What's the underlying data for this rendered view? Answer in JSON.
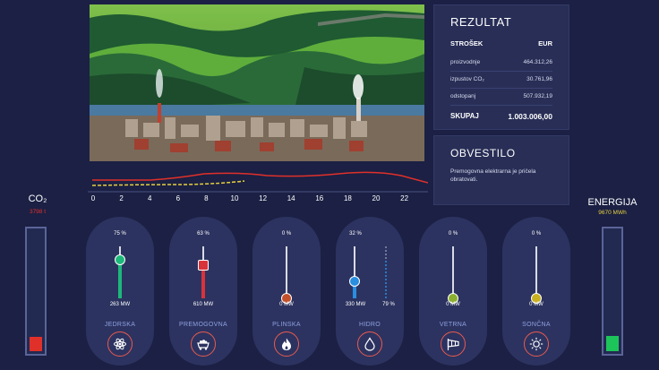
{
  "result": {
    "title": "REZULTAT",
    "col_label": "STROŠEK",
    "col_unit": "EUR",
    "rows": [
      {
        "label": "proizvodnje",
        "value": "464.312,26"
      },
      {
        "label": "izpustov CO₂",
        "value": "30.761,96"
      },
      {
        "label": "odstopanj",
        "value": "507.932,19"
      }
    ],
    "total_label": "SKUPAJ",
    "total_value": "1.003.006,00"
  },
  "notice": {
    "title": "OBVESTILO",
    "text": "Premogovna elektrarna je pričela obratovati."
  },
  "co2": {
    "label": "CO₂",
    "value": "3798 t",
    "level": 0.12,
    "color": "#e0302a"
  },
  "energy": {
    "label": "ENERGIJA",
    "value": "9670 MWh",
    "level": 0.13,
    "color": "#1dc45a"
  },
  "timeline": {
    "ticks": [
      "0",
      "2",
      "4",
      "6",
      "8",
      "10",
      "12",
      "14",
      "16",
      "18",
      "20",
      "22"
    ],
    "demand_color": "#e0302a",
    "supply_color": "#e8d040"
  },
  "plants": [
    {
      "name": "JEDRSKA",
      "percent": "75 %",
      "power": "263 MW",
      "level": 0.75,
      "color": "#1db87a",
      "icon": "atom-icon"
    },
    {
      "name": "PREMOGOVNA",
      "percent": "63 %",
      "power": "610 MW",
      "level": 0.63,
      "color": "#d8333a",
      "icon": "coal-cart-icon"
    },
    {
      "name": "PLINSKA",
      "percent": "0 %",
      "power": "0 MW",
      "level": 0.0,
      "color": "#c2502a",
      "icon": "gas-flame-icon"
    },
    {
      "name": "HIDRO",
      "percent": "32 %",
      "power": "330 MW",
      "level": 0.32,
      "reserve": "79 %",
      "reserve_level": 0.79,
      "color": "#2a8ee0",
      "icon": "water-drop-icon"
    },
    {
      "name": "VETRNA",
      "percent": "0 %",
      "power": "0 MW",
      "level": 0.0,
      "color": "#8bb030",
      "icon": "windsock-icon"
    },
    {
      "name": "SONČNA",
      "percent": "0 %",
      "power": "0 MW",
      "level": 0.0,
      "color": "#c8b020",
      "icon": "sun-icon"
    }
  ]
}
